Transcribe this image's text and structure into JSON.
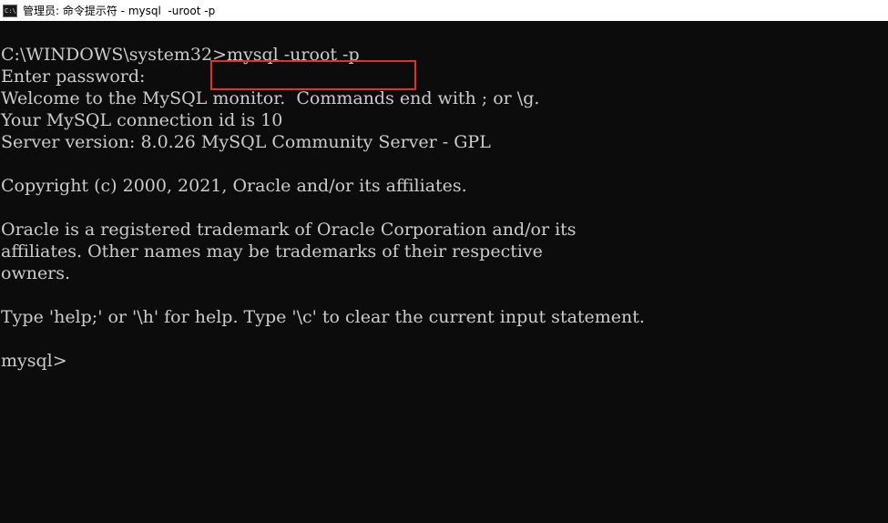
{
  "window": {
    "title": "管理员: 命令提示符 - mysql  -uroot -p",
    "icon": "cmd-icon",
    "icon_glyph": "C:\\"
  },
  "console": {
    "lines": [
      "C:\\WINDOWS\\system32>mysql -uroot -p",
      "Enter password:",
      "Welcome to the MySQL monitor.  Commands end with ; or \\g.",
      "Your MySQL connection id is 10",
      "Server version: 8.0.26 MySQL Community Server - GPL",
      "",
      "Copyright (c) 2000, 2021, Oracle and/or its affiliates.",
      "",
      "Oracle is a registered trademark of Oracle Corporation and/or its",
      "affiliates. Other names may be trademarks of their respective",
      "owners.",
      "",
      "Type 'help;' or '\\h' for help. Type '\\c' to clear the current input statement.",
      "",
      "mysql>"
    ]
  },
  "highlight": {
    "color": "#e03030"
  },
  "colors": {
    "background": "#0c0c0c",
    "text": "#cccccc",
    "titlebar": "#ffffff"
  }
}
